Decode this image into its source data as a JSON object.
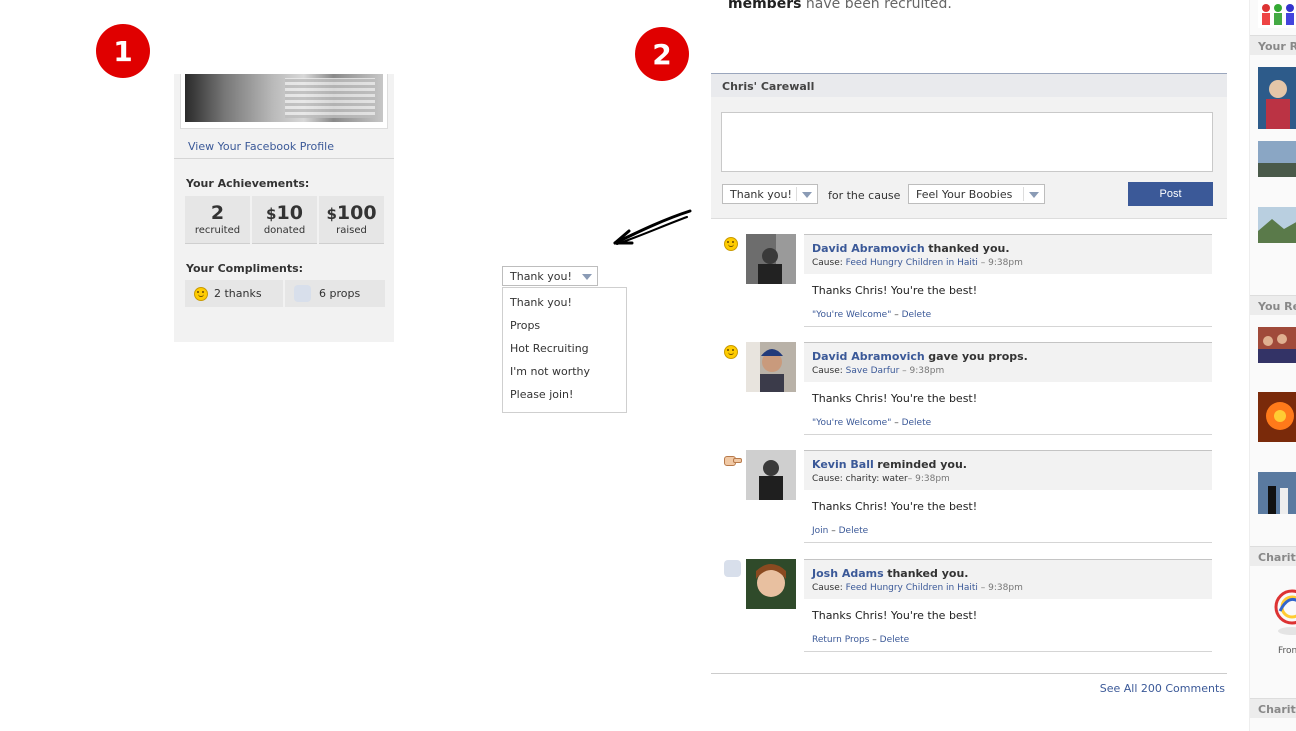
{
  "badges": {
    "one": "1",
    "two": "2"
  },
  "panel1": {
    "profile_link": "View Your Facebook Profile",
    "achievements_title": "Your Achievements:",
    "stats": [
      {
        "currency": "",
        "value": "2",
        "label": "recruited"
      },
      {
        "currency": "$",
        "value": "10",
        "label": "donated"
      },
      {
        "currency": "$",
        "value": "100",
        "label": "raised"
      }
    ],
    "compliments_title": "Your Compliments:",
    "compliments": [
      {
        "icon": "smiley-icon",
        "text": "2 thanks"
      },
      {
        "icon": "props-icon",
        "text": "6 props"
      }
    ]
  },
  "dropdown_demo": {
    "selected": "Thank you!",
    "options": [
      "Thank you!",
      "Props",
      "Hot Recruiting",
      "I'm not worthy",
      "Please join!"
    ]
  },
  "recruit_banner": {
    "bold": "members",
    "rest": " have been recruited."
  },
  "carewall": {
    "title": "Chris' Carewall",
    "compliment_select": "Thank you!",
    "for_cause_label": "for the cause",
    "cause_select": "Feel Your Boobies",
    "post_button": "Post"
  },
  "comments": [
    {
      "icon": "smiley-icon",
      "author": "David Abramovich",
      "action": "thanked you.",
      "cause_label": "Cause:",
      "cause": "Feed Hungry Children in Haiti",
      "time": " – 9:38pm",
      "text": "Thanks Chris! You're the best!",
      "action1": "\"You're Welcome\"",
      "sep": " – ",
      "action2": "Delete"
    },
    {
      "icon": "smiley-icon",
      "author": "David Abramovich",
      "action": "gave you props.",
      "cause_label": "Cause:",
      "cause": "Save Darfur",
      "time": " – 9:38pm",
      "text": "Thanks Chris! You're the best!",
      "action1": "\"You're Welcome\"",
      "sep": " – ",
      "action2": "Delete"
    },
    {
      "icon": "pointing-hand-icon",
      "author": "Kevin Ball",
      "action": "reminded you.",
      "cause_label": "Cause:",
      "cause": "charity: water",
      "time": "– 9:38pm",
      "text": "Thanks Chris! You're the best!",
      "action1": "Join",
      "sep": " – ",
      "action2": "Delete"
    },
    {
      "icon": "props-icon",
      "author": "Josh Adams",
      "action": "thanked you.",
      "cause_label": "Cause:",
      "cause": "Feed Hungry Children in Haiti",
      "time": " – 9:38pm",
      "text": "Thanks Chris! You're the best!",
      "action1": "Return Props",
      "sep": " – ",
      "action2": "Delete"
    }
  ],
  "see_all": "See All 200 Comments",
  "right_sidebar": {
    "sections": [
      "Your Re",
      "You Re",
      "Charity",
      "Charity"
    ],
    "footer": "Fron"
  },
  "colors": {
    "link": "#3b5998",
    "badge": "#e00000",
    "button": "#3b5998"
  }
}
